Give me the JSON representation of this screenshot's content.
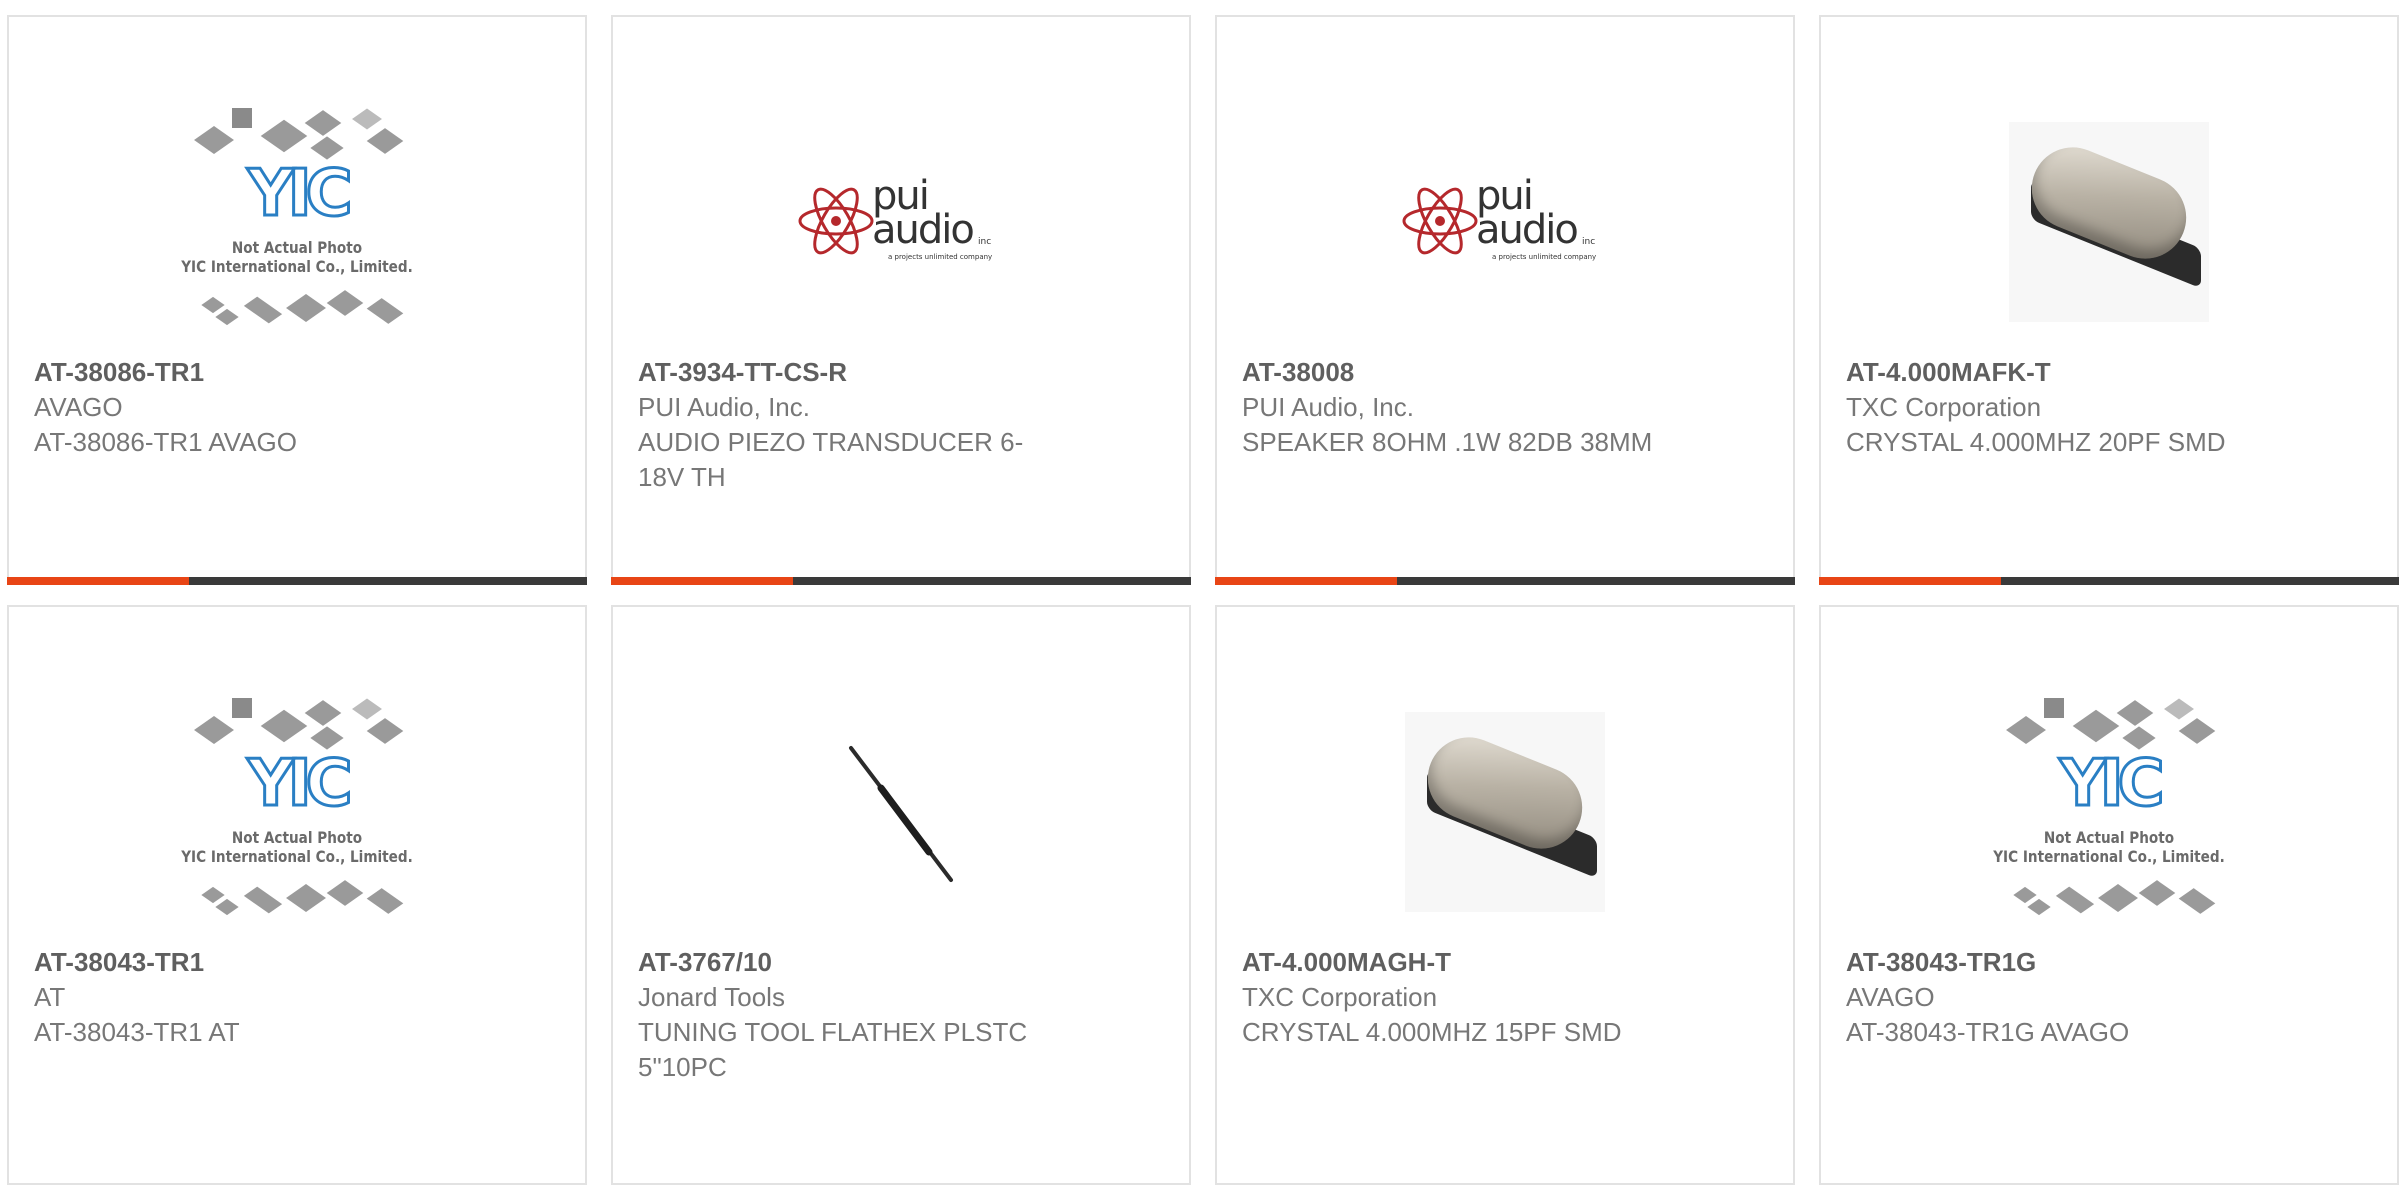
{
  "products": [
    {
      "part_number": "AT-38086-TR1",
      "manufacturer": "AVAGO",
      "description": "AT-38086-TR1 AVAGO",
      "image": "yic-placeholder"
    },
    {
      "part_number": "AT-3934-TT-CS-R",
      "manufacturer": "PUI Audio, Inc.",
      "description": "AUDIO PIEZO TRANSDUCER 6-18V TH",
      "image": "pui-audio-logo"
    },
    {
      "part_number": "AT-38008",
      "manufacturer": "PUI Audio, Inc.",
      "description": "SPEAKER 8OHM .1W 82DB 38MM",
      "image": "pui-audio-logo"
    },
    {
      "part_number": "AT-4.000MAFK-T",
      "manufacturer": "TXC Corporation",
      "description": "CRYSTAL 4.000MHZ 20PF SMD",
      "image": "crystal-photo"
    },
    {
      "part_number": "AT-38043-TR1",
      "manufacturer": "AT",
      "description": "AT-38043-TR1 AT",
      "image": "yic-placeholder"
    },
    {
      "part_number": "AT-3767/10",
      "manufacturer": "Jonard Tools",
      "description": "TUNING TOOL FLATHEX PLSTC 5\"10PC",
      "image": "tuning-tool-photo"
    },
    {
      "part_number": "AT-4.000MAGH-T",
      "manufacturer": "TXC Corporation",
      "description": "CRYSTAL 4.000MHZ 15PF SMD",
      "image": "crystal-photo"
    },
    {
      "part_number": "AT-38043-TR1G",
      "manufacturer": "AVAGO",
      "description": "AT-38043-TR1G AVAGO",
      "image": "yic-placeholder"
    }
  ],
  "placeholder": {
    "logo_text": "YIC",
    "line1": "Not Actual Photo",
    "line2": "YIC International Co., Limited."
  },
  "pui_logo": {
    "line1": "pui",
    "line2": "audio",
    "inc": "inc",
    "tagline": "a projects unlimited company"
  },
  "colors": {
    "accent": "#e84515",
    "bar": "#3a3a3a",
    "border": "#e2e2e2",
    "yic_blue": "#2a7fc4",
    "pui_red": "#b5282c"
  }
}
